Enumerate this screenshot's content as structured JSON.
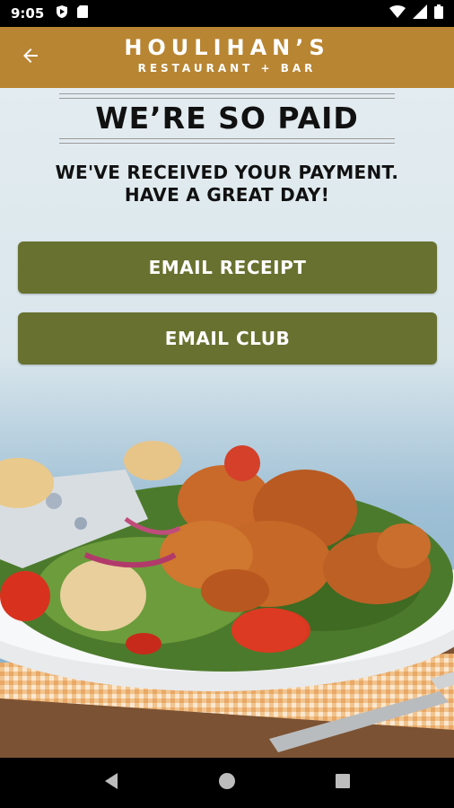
{
  "status_bar": {
    "time": "9:05",
    "icons": [
      "shield-icon",
      "sim-card-icon",
      "wifi-icon",
      "signal-icon",
      "battery-icon"
    ]
  },
  "header": {
    "brand_name": "HOULIHAN’S",
    "brand_sub": "RESTAURANT + BAR",
    "back_icon": "arrow-left-icon",
    "color": "#b88532"
  },
  "main": {
    "title": "WE’RE SO PAID",
    "message": "WE'VE RECEIVED YOUR PAYMENT. HAVE A GREAT DAY!",
    "buttons": {
      "email_receipt": "EMAIL RECEIPT",
      "email_club": "EMAIL CLUB"
    },
    "button_color": "#68712f"
  },
  "nav_bar": {
    "icons": [
      "back-triangle-icon",
      "home-circle-icon",
      "recents-square-icon"
    ]
  }
}
